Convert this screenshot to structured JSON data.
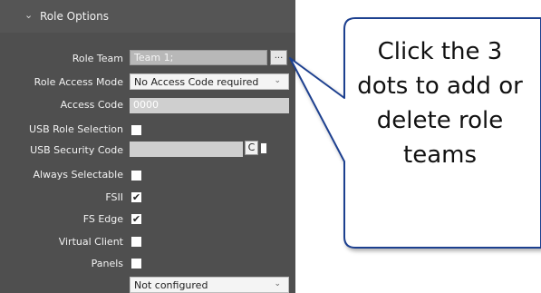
{
  "panel": {
    "title": "Role Options",
    "role_team": {
      "label": "Role Team",
      "value": "Team 1;",
      "button_label": "..."
    },
    "role_access_mode": {
      "label": "Role Access Mode",
      "value": "No Access Code required"
    },
    "access_code": {
      "label": "Access Code",
      "value": "0000"
    },
    "usb_role_selection": {
      "label": "USB Role Selection",
      "checked": false
    },
    "usb_security_code": {
      "label": "USB Security Code",
      "refresh_symbol": "C"
    },
    "always_selectable": {
      "label": "Always Selectable",
      "checked": false
    },
    "fsii": {
      "label": "FSII",
      "checked": true,
      "mark": "✔"
    },
    "fs_edge": {
      "label": "FS Edge",
      "checked": true,
      "mark": "✔"
    },
    "virtual_client": {
      "label": "Virtual Client",
      "checked": false
    },
    "panels": {
      "label": "Panels",
      "checked": false
    },
    "bottom_select": {
      "value": "Not configured"
    }
  },
  "callout": {
    "lines": [
      "Click the 3",
      "dots to add or",
      "delete role",
      "teams"
    ]
  },
  "colors": {
    "panel_bg": "#4f4f4f",
    "callout_border": "#1f3f8f"
  }
}
